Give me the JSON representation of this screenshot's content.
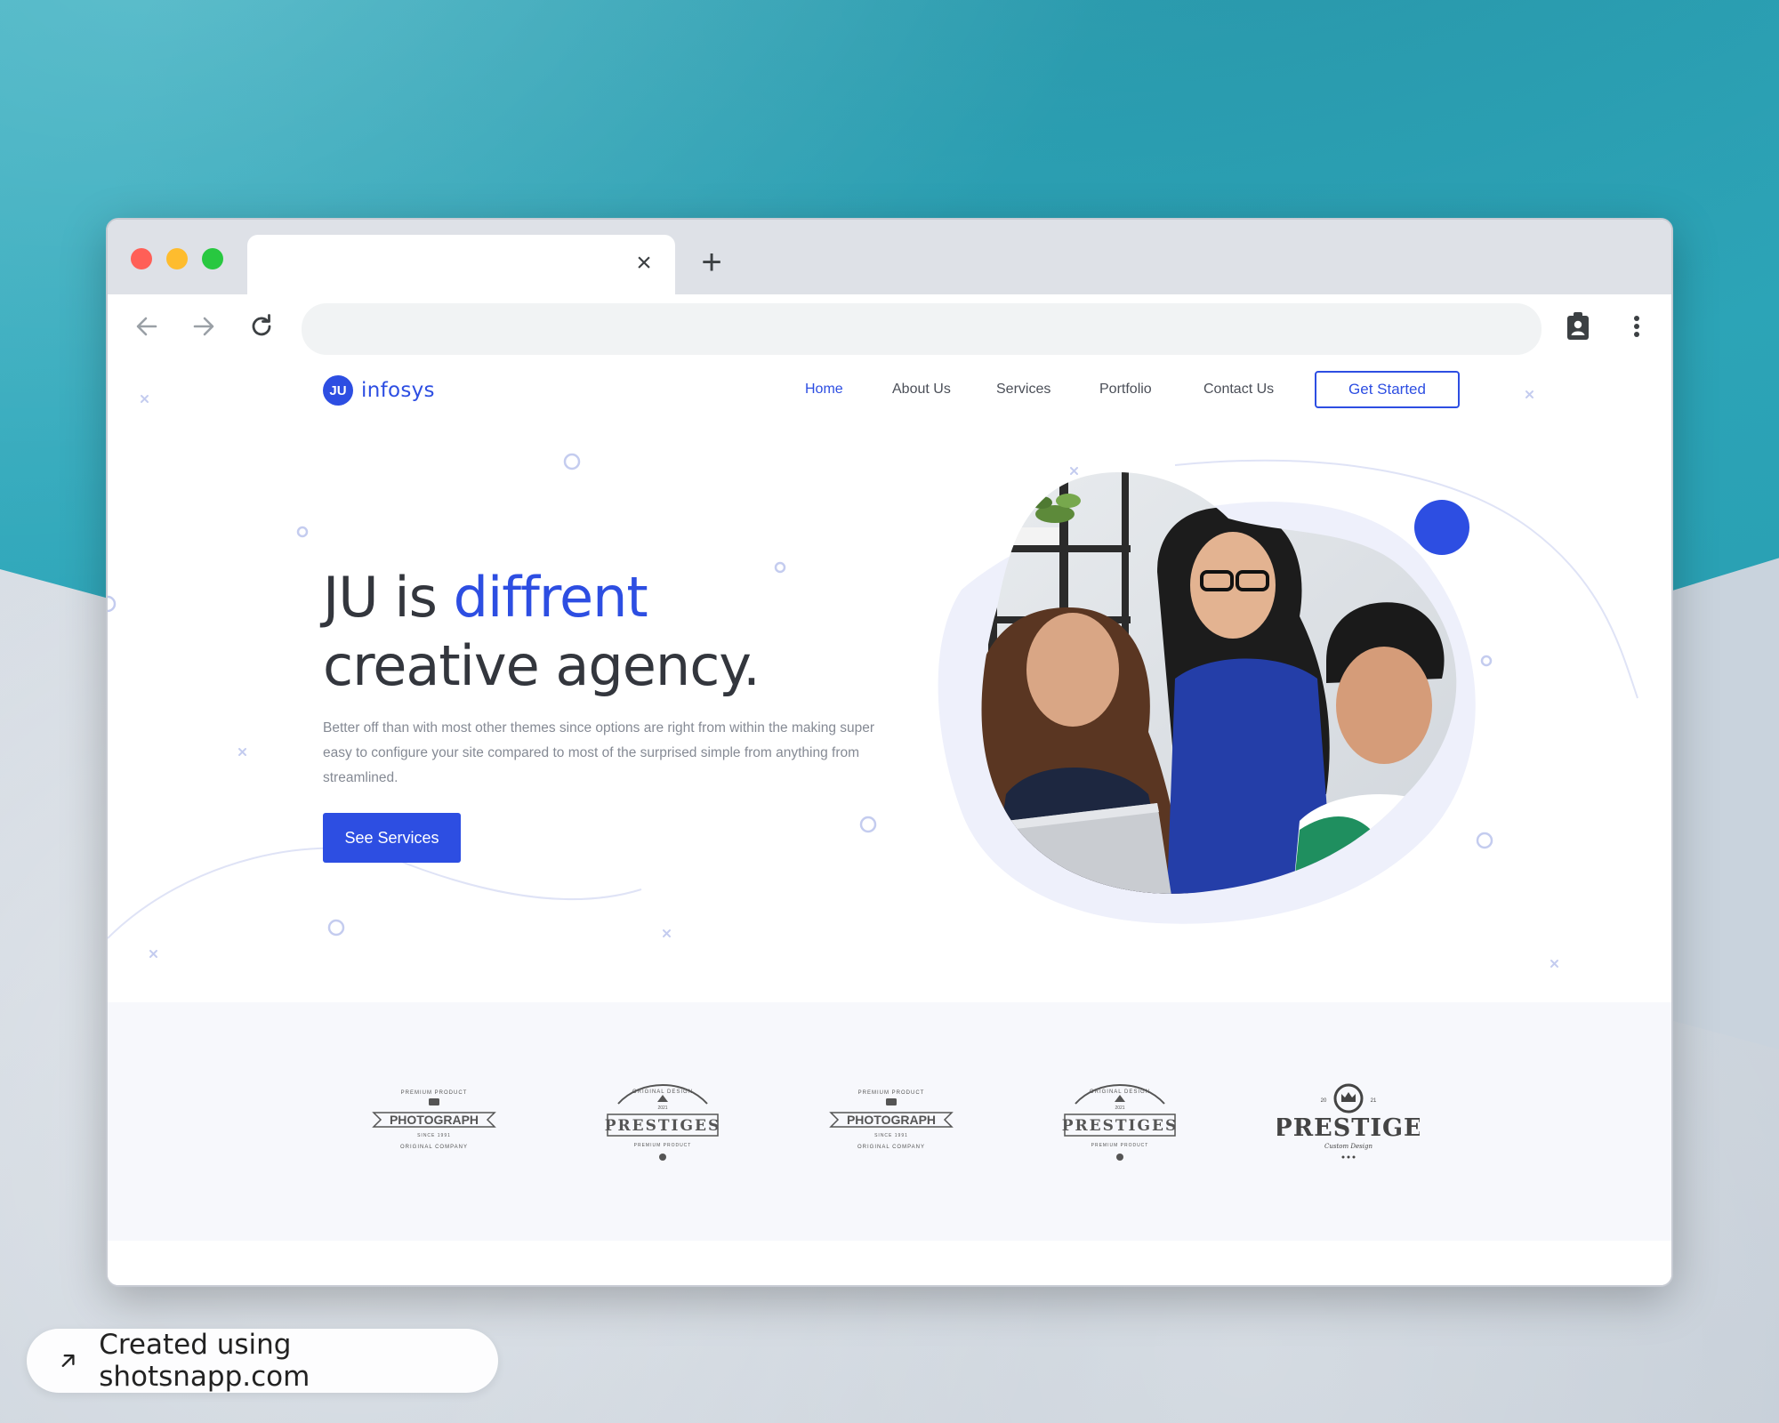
{
  "browser": {
    "tab_title": "",
    "tab_close_glyph": "×",
    "new_tab_glyph": "+",
    "address_value": "",
    "traffic_lights": {
      "close": "#ff5f57",
      "minimize": "#febc2e",
      "zoom": "#28c840"
    },
    "toolbar_icons": [
      "back-arrow-icon",
      "forward-arrow-icon",
      "reload-icon",
      "profile-badge-icon",
      "kebab-menu-icon"
    ]
  },
  "site": {
    "brand": {
      "badge": "JU",
      "name": "infosys"
    },
    "nav": {
      "items": [
        {
          "label": "Home",
          "active": true
        },
        {
          "label": "About Us",
          "active": false
        },
        {
          "label": "Services",
          "active": false
        },
        {
          "label": "Portfolio",
          "active": false
        },
        {
          "label": "Contact Us",
          "active": false
        }
      ],
      "cta": "Get Started"
    },
    "hero": {
      "title_prefix": "JU is ",
      "title_accent": "diffrent",
      "title_line2": "creative agency.",
      "description": "Better off than with most other themes since options are right from within the making super easy to configure your site compared to most of the surprised simple from anything from streamlined.",
      "cta": "See Services",
      "image_alt": "Three colleagues smiling at a laptop"
    },
    "brands": [
      {
        "type": "badge-arc",
        "name": "PHOTOGRAPH",
        "top": "PREMIUM PRODUCT",
        "middle": "SINCE 1991",
        "bottom": "ORIGINAL COMPANY"
      },
      {
        "type": "badge-ribbon",
        "name": "PRESTIGES",
        "top": "ORIGINAL DESIGN",
        "middle": "2021",
        "bottom": "PREMIUM PRODUCT"
      },
      {
        "type": "badge-arc",
        "name": "PHOTOGRAPH",
        "top": "PREMIUM PRODUCT",
        "middle": "SINCE 1991",
        "bottom": "ORIGINAL COMPANY"
      },
      {
        "type": "badge-ribbon",
        "name": "PRESTIGES",
        "top": "ORIGINAL DESIGN",
        "middle": "2021",
        "bottom": "PREMIUM PRODUCT"
      },
      {
        "type": "badge-crown",
        "name": "PRESTIGE",
        "top": "20",
        "middle": "21",
        "bottom": "Custom Design"
      }
    ],
    "colors": {
      "accent": "#2d4ee2",
      "text_dark": "#33363d",
      "text_muted": "#858a94",
      "strip_bg": "#f7f8fc"
    }
  },
  "watermark": {
    "text": "Created using shotsnapp.com",
    "icon": "external-arrow-icon"
  }
}
